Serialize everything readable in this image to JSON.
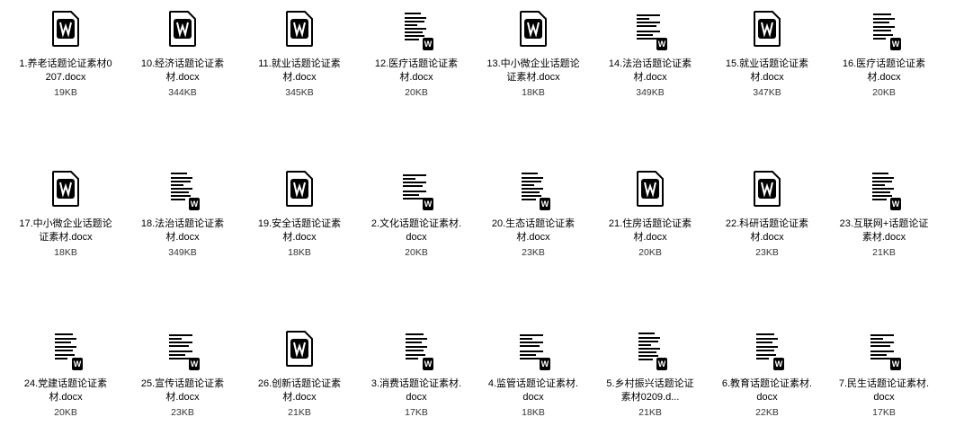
{
  "files": [
    {
      "name": "1.养老话题论证素材0207.docx",
      "size": "19KB",
      "icon": "wps-doc-icon"
    },
    {
      "name": "10.经济话题论证素材.docx",
      "size": "344KB",
      "icon": "wps-doc-icon"
    },
    {
      "name": "11.就业话题论证素材.docx",
      "size": "345KB",
      "icon": "wps-doc-icon"
    },
    {
      "name": "12.医疗话题论证素材.docx",
      "size": "20KB",
      "icon": "word-thumbnail-icon"
    },
    {
      "name": "13.中小微企业话题论证素材.docx",
      "size": "18KB",
      "icon": "wps-doc-icon"
    },
    {
      "name": "14.法治话题论证素材.docx",
      "size": "349KB",
      "icon": "word-thumbnail-icon"
    },
    {
      "name": "15.就业话题论证素材.docx",
      "size": "347KB",
      "icon": "wps-doc-icon"
    },
    {
      "name": "16.医疗话题论证素材.docx",
      "size": "20KB",
      "icon": "word-thumbnail-icon"
    },
    {
      "name": "17.中小微企业话题论证素材.docx",
      "size": "18KB",
      "icon": "wps-doc-icon"
    },
    {
      "name": "18.法治话题论证素材.docx",
      "size": "349KB",
      "icon": "word-thumbnail-icon"
    },
    {
      "name": "19.安全话题论证素材.docx",
      "size": "18KB",
      "icon": "wps-doc-icon"
    },
    {
      "name": "2.文化话题论证素材.docx",
      "size": "20KB",
      "icon": "word-thumbnail-icon"
    },
    {
      "name": "20.生态话题论证素材.docx",
      "size": "23KB",
      "icon": "word-thumbnail-icon"
    },
    {
      "name": "21.住房话题论证素材.docx",
      "size": "20KB",
      "icon": "wps-doc-icon"
    },
    {
      "name": "22.科研话题论证素材.docx",
      "size": "23KB",
      "icon": "wps-doc-icon"
    },
    {
      "name": "23.互联网+话题论证素材.docx",
      "size": "21KB",
      "icon": "word-thumbnail-icon"
    },
    {
      "name": "24.党建话题论证素材.docx",
      "size": "20KB",
      "icon": "word-thumbnail-icon"
    },
    {
      "name": "25.宣传话题论证素材.docx",
      "size": "23KB",
      "icon": "word-thumbnail-icon"
    },
    {
      "name": "26.创新话题论证素材.docx",
      "size": "21KB",
      "icon": "wps-doc-icon"
    },
    {
      "name": "3.消费话题论证素材.docx",
      "size": "17KB",
      "icon": "word-thumbnail-icon"
    },
    {
      "name": "4.监管话题论证素材.docx",
      "size": "18KB",
      "icon": "word-thumbnail-icon"
    },
    {
      "name": "5.乡村振兴话题论证素材0209.d...",
      "size": "21KB",
      "icon": "word-thumbnail-icon"
    },
    {
      "name": "6.教育话题论证素材.docx",
      "size": "22KB",
      "icon": "word-thumbnail-icon"
    },
    {
      "name": "7.民生话题论证素材.docx",
      "size": "17KB",
      "icon": "word-thumbnail-icon"
    }
  ],
  "badge_letter": "W"
}
